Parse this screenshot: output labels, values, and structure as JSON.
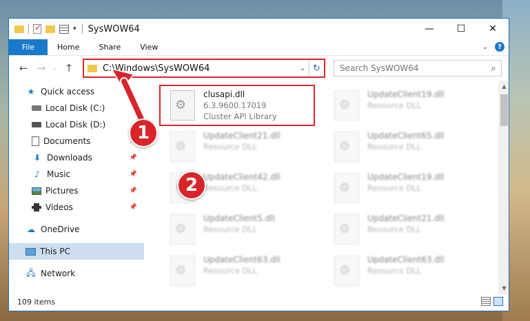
{
  "window": {
    "title": "SysWOW64",
    "controls": {
      "minimize": "—",
      "maximize": "☐",
      "close": "✕"
    }
  },
  "ribbon": {
    "tabs": [
      "File",
      "Home",
      "Share",
      "View"
    ],
    "help": "?"
  },
  "address": {
    "path": "C:\\Windows\\SysWOW64",
    "search_placeholder": "Search SysWOW64"
  },
  "sidebar": {
    "items": [
      {
        "label": "Quick access",
        "icon": "star-icon"
      },
      {
        "label": "Local Disk (C:)",
        "icon": "disk-icon"
      },
      {
        "label": "Local Disk (D:)",
        "icon": "disk-icon"
      },
      {
        "label": "Documents",
        "icon": "document-icon"
      },
      {
        "label": "Downloads",
        "icon": "download-icon"
      },
      {
        "label": "Music",
        "icon": "music-icon"
      },
      {
        "label": "Pictures",
        "icon": "pictures-icon"
      },
      {
        "label": "Videos",
        "icon": "videos-icon"
      },
      {
        "label": "OneDrive",
        "icon": "cloud-icon"
      },
      {
        "label": "This PC",
        "icon": "computer-icon"
      },
      {
        "label": "Network",
        "icon": "network-icon"
      }
    ]
  },
  "files": [
    {
      "name": "clusapi.dll",
      "line2": "6.3.9600.17019",
      "line3": "Cluster API Library"
    },
    {
      "name": "UpdateClient19.dll",
      "line2": "Resource DLL"
    },
    {
      "name": "UpdateClient21.dll",
      "line2": "Resource DLL"
    },
    {
      "name": "UpdateClient65.dll",
      "line2": "Resource DLL"
    },
    {
      "name": "UpdateClient42.dll",
      "line2": "Resource DLL"
    },
    {
      "name": "UpdateClient19.dll",
      "line2": "Resource DLL"
    },
    {
      "name": "UpdateClient5.dll",
      "line2": "Resource DLL"
    },
    {
      "name": "UpdateClient21.dll",
      "line2": "Resource DLL"
    },
    {
      "name": "UpdateClient63.dll",
      "line2": "Resource DLL"
    },
    {
      "name": "UpdateClient63.dll",
      "line2": "Resource DLL"
    }
  ],
  "status": {
    "count": "109 items"
  },
  "annotations": {
    "step1": "1",
    "step2": "2"
  },
  "colors": {
    "accent": "#1979ca",
    "highlight": "#d9252a"
  }
}
